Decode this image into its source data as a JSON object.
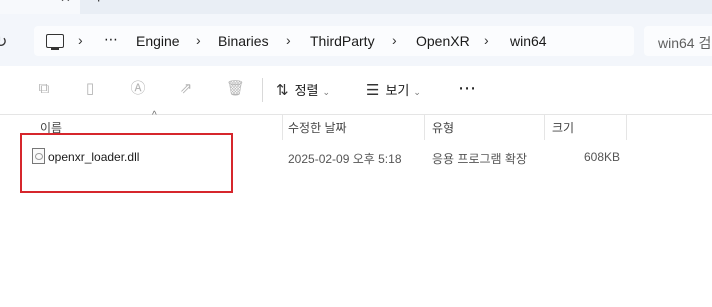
{
  "tabs": {
    "close_glyph": "✕",
    "new_glyph": "+"
  },
  "address": {
    "refresh_glyph": "↻",
    "overflow": "⋯",
    "crumbs": [
      "Engine",
      "Binaries",
      "ThirdParty",
      "OpenXR",
      "win64"
    ],
    "search_placeholder": "win64 검"
  },
  "toolbar": {
    "sort_label": "정렬",
    "view_label": "보기",
    "more_label": "⋯",
    "dropdown_glyph": "⌄"
  },
  "columns": {
    "name": "이름",
    "modified": "수정한 날짜",
    "type": "유형",
    "size": "크기",
    "sort_glyph": "^"
  },
  "files": [
    {
      "name": "openxr_loader.dll",
      "modified": "2025-02-09 오후 5:18",
      "type": "응용 프로그램 확장",
      "size": "608KB"
    }
  ],
  "colors": {
    "highlight": "#d6262c",
    "address_bg": "#f3f6fb"
  }
}
